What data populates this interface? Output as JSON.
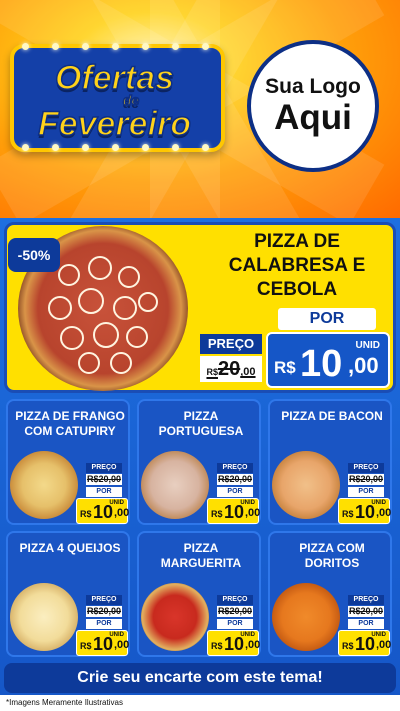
{
  "header": {
    "banner_line1": "Ofertas",
    "banner_line2": "de",
    "banner_line3": "Fevereiro",
    "logo_line1": "Sua Logo",
    "logo_line2": "Aqui"
  },
  "featured": {
    "discount": "-50%",
    "title_line1": "PIZZA DE",
    "title_line2": "CALABRESA E",
    "title_line3": "CEBOLA",
    "preco_label": "PREÇO",
    "old_currency": "R$",
    "old_price": "20",
    "old_cents": ",00",
    "por_label": "POR",
    "unid_label": "UNID",
    "currency": "R$",
    "price": "10",
    "cents": ",00"
  },
  "products": [
    {
      "name_line1": "PIZZA DE FRANGO",
      "name_line2": "COM CATUPIRY",
      "preco_label": "PREÇO",
      "old_price": "R$20,00",
      "por_label": "POR",
      "unid_label": "UNID",
      "currency": "R$",
      "price": "10",
      "cents": ",00"
    },
    {
      "name_line1": "PIZZA",
      "name_line2": "PORTUGUESA",
      "preco_label": "PREÇO",
      "old_price": "R$20,00",
      "por_label": "POR",
      "unid_label": "UNID",
      "currency": "R$",
      "price": "10",
      "cents": ",00"
    },
    {
      "name_line1": "PIZZA DE BACON",
      "name_line2": "",
      "preco_label": "PREÇO",
      "old_price": "R$20,00",
      "por_label": "POR",
      "unid_label": "UNID",
      "currency": "R$",
      "price": "10",
      "cents": ",00"
    },
    {
      "name_line1": "PIZZA 4 QUEIJOS",
      "name_line2": "",
      "preco_label": "PREÇO",
      "old_price": "R$20,00",
      "por_label": "POR",
      "unid_label": "UNID",
      "currency": "R$",
      "price": "10",
      "cents": ",00"
    },
    {
      "name_line1": "PIZZA",
      "name_line2": "MARGUERITA",
      "preco_label": "PREÇO",
      "old_price": "R$20,00",
      "por_label": "POR",
      "unid_label": "UNID",
      "currency": "R$",
      "price": "10",
      "cents": ",00"
    },
    {
      "name_line1": "PIZZA COM",
      "name_line2": "DORITOS",
      "preco_label": "PREÇO",
      "old_price": "R$20,00",
      "por_label": "POR",
      "unid_label": "UNID",
      "currency": "R$",
      "price": "10",
      "cents": ",00"
    }
  ],
  "cta": "Crie seu encarte com este tema!",
  "footnote": "*Imagens Meramente Ilustrativas",
  "colors": {
    "brand_blue": "#1556c7",
    "dark_blue": "#0d3a9a",
    "yellow": "#ffe000",
    "orange": "#ff9f0a"
  }
}
